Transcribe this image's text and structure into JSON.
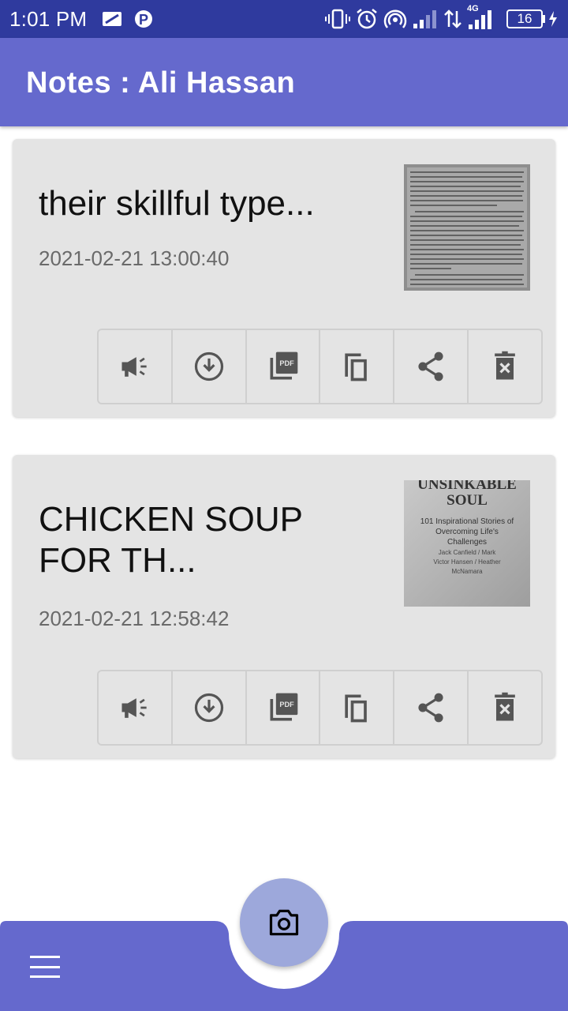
{
  "status_bar": {
    "time": "1:01 PM",
    "network_label": "4G",
    "battery_level": "16"
  },
  "app_bar": {
    "title": "Notes : Ali Hassan"
  },
  "notes": [
    {
      "title": "their skillful type...",
      "date": "2021-02-21 13:00:40",
      "thumbnail": "scanned-text-page"
    },
    {
      "title": "CHICKEN SOUP FOR TH...",
      "date": "2021-02-21 12:58:42",
      "thumbnail": "book-cover-page",
      "thumbnail_text": {
        "heading": "UNSINKABLE SOUL",
        "subtitle": "101 Inspirational Stories of Overcoming Life's Challenges",
        "authors": "Jack Canfield / Mark Victor Hansen / Heather McNamara"
      }
    }
  ],
  "note_actions": [
    "megaphone-icon",
    "download-icon",
    "pdf-icon",
    "copy-icon",
    "share-icon",
    "delete-icon"
  ],
  "bottom_bar": {
    "menu_icon": "hamburger-menu-icon",
    "fab_icon": "camera-icon"
  },
  "colors": {
    "status_bar": "#2f3a9e",
    "app_bar": "#6569cd",
    "card": "#e4e4e4",
    "fab": "#9da8db"
  }
}
